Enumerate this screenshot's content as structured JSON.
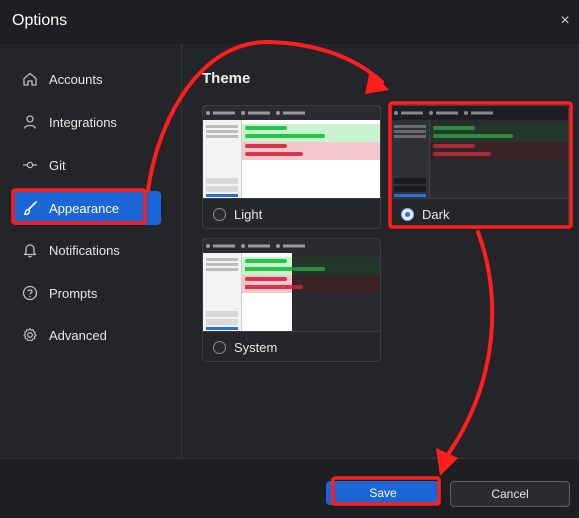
{
  "window": {
    "title": "Options",
    "close_glyph": "×"
  },
  "sidebar": {
    "items": [
      {
        "label": "Accounts",
        "icon": "home-icon",
        "active": false
      },
      {
        "label": "Integrations",
        "icon": "person-icon",
        "active": false
      },
      {
        "label": "Git",
        "icon": "git-commit-icon",
        "active": false
      },
      {
        "label": "Appearance",
        "icon": "brush-icon",
        "active": true
      },
      {
        "label": "Notifications",
        "icon": "bell-icon",
        "active": false
      },
      {
        "label": "Prompts",
        "icon": "question-icon",
        "active": false
      },
      {
        "label": "Advanced",
        "icon": "gear-icon",
        "active": false
      }
    ]
  },
  "main": {
    "section_title": "Theme",
    "themes": [
      {
        "label": "Light",
        "selected": false
      },
      {
        "label": "Dark",
        "selected": true
      },
      {
        "label": "System",
        "selected": false
      }
    ]
  },
  "footer": {
    "save_label": "Save",
    "cancel_label": "Cancel"
  },
  "colors": {
    "accent": "#1a66d6",
    "annotation": "#ff1e1e",
    "background": "#242528"
  }
}
